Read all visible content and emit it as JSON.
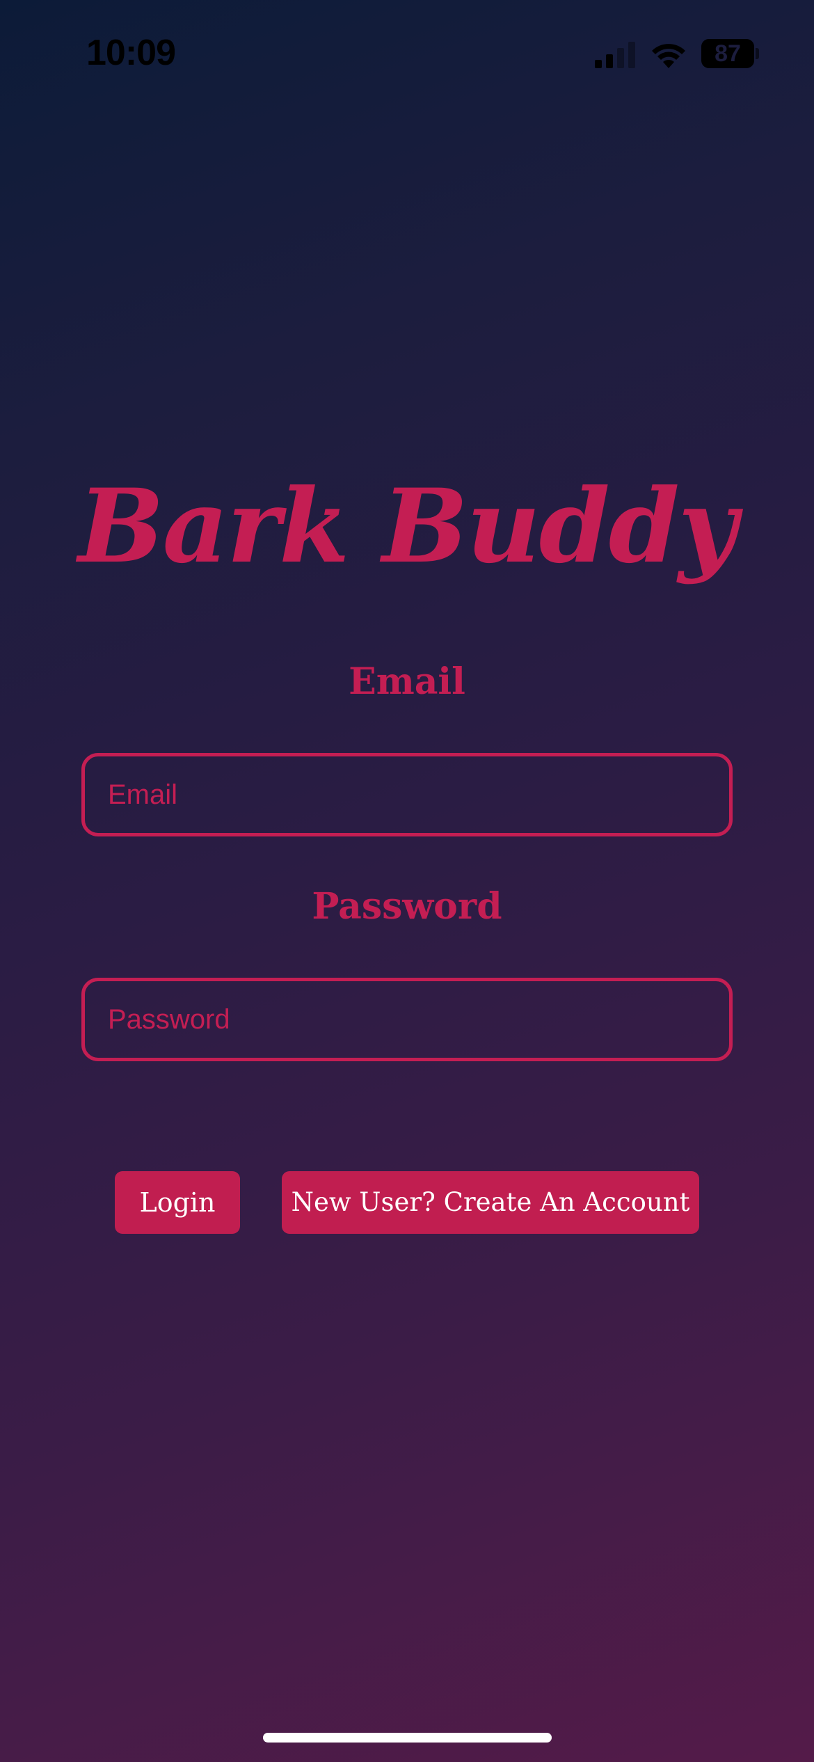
{
  "status_bar": {
    "time": "10:09",
    "battery_level": "87",
    "icons": [
      "cellular-signal-icon",
      "wifi-icon",
      "battery-icon"
    ]
  },
  "app": {
    "title": "Bark Buddy"
  },
  "form": {
    "email_label": "Email",
    "email_placeholder": "Email",
    "email_value": "",
    "password_label": "Password",
    "password_placeholder": "Password",
    "password_value": ""
  },
  "actions": {
    "login_label": "Login",
    "create_account_label": "New User? Create An Account"
  },
  "colors": {
    "accent": "#C41E53",
    "button_text": "#FFFFFF",
    "background_top": "#0C1B38",
    "background_bottom": "#541B49"
  }
}
